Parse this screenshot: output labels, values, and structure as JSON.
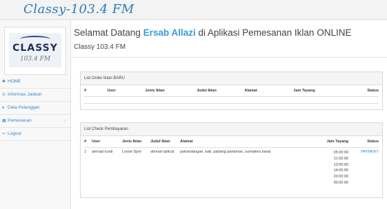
{
  "brand": "Classy-103.4 FM",
  "logo": {
    "text": "CLASSY",
    "sub": "103.4 FM"
  },
  "nav": [
    {
      "label": "HOME",
      "icon": "home-icon",
      "glyph": "✱"
    },
    {
      "label": "Informasi Jadwal",
      "icon": "clock-icon",
      "glyph": "⊙"
    },
    {
      "label": "Data Pelanggan",
      "icon": "person-icon",
      "glyph": "♦"
    },
    {
      "label": "Pemesanan",
      "icon": "calendar-icon",
      "glyph": "▦",
      "chevron": "‹"
    },
    {
      "label": "Logout",
      "icon": "logout-icon",
      "glyph": "⇨"
    }
  ],
  "header": {
    "welcome_prefix": "Selamat Datang ",
    "user_name": "Ersab Allazi",
    "welcome_suffix": " di Aplikasi Pemesanan Iklan ONLINE",
    "subtitle": "Classy 103.4 FM"
  },
  "order_panel": {
    "title": "List Order Iklan BARU",
    "columns": [
      "#",
      "User",
      "Jenis Iklan",
      "Judul Iklan",
      "Alamat",
      "Jam Tayang",
      "Status"
    ]
  },
  "payment_panel": {
    "title": "List Check Pembayaran",
    "columns": [
      "#",
      "User",
      "Jenis Iklan",
      "Judul Iklan",
      "Alamat",
      "Jam Tayang",
      "Status"
    ],
    "rows": [
      {
        "no": "1",
        "user": "ahmad rusdi",
        "jenis": "Loose Spot",
        "judul": "ahmad optical",
        "alamat": "pakandangan, kab. padang pariaman, sumatera barat",
        "jam": [
          "05:00:00",
          "11:00:00",
          "13:00:00",
          "14:00:00",
          "20:00:00",
          "00:00:00"
        ],
        "status": "PAYMENT"
      }
    ]
  },
  "colors": {
    "accent": "#3a87c6",
    "user_name": "#3a9ad9",
    "brand": "#2b7bb9"
  }
}
